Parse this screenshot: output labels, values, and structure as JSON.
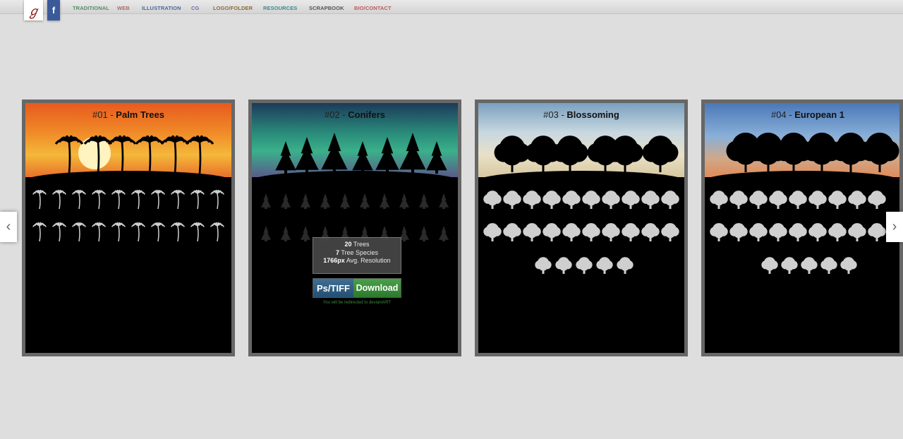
{
  "nav": {
    "logo_glyph": "ℊ",
    "facebook_glyph": "f",
    "items": [
      {
        "label": "TRADITIONAL",
        "color": "#5a8a6a"
      },
      {
        "label": "WEB",
        "color": "#b06a6a"
      },
      {
        "label": "ILLUSTRATION",
        "color": "#4a6a9a"
      },
      {
        "label": "CG",
        "color": "#7a6aaa"
      },
      {
        "label": "LOGO/FOLDER",
        "color": "#8a6a3a"
      },
      {
        "label": "RESOURCES",
        "color": "#3a8a8a"
      },
      {
        "label": "SCRAPBOOK",
        "color": "#555555"
      },
      {
        "label": "BIO/CONTACT",
        "color": "#c05a5a"
      }
    ]
  },
  "carousel": {
    "prev_glyph": "‹",
    "next_glyph": "›",
    "cards": [
      {
        "number": "#01 - ",
        "name": "Palm Trees"
      },
      {
        "number": "#02 - ",
        "name": "Conifers"
      },
      {
        "number": "#03 - ",
        "name": "Blossoming"
      },
      {
        "number": "#04 - ",
        "name": "European 1"
      }
    ],
    "overlay": {
      "trees_count": "20",
      "trees_label": " Trees",
      "species_count": "7",
      "species_label": " Tree Species",
      "resolution": "1766px",
      "resolution_label": " Avg. Resolution",
      "format_button": "Ps/TIFF",
      "download_button": "Download",
      "redirect_note": "You will be redirected to deviantART"
    }
  }
}
